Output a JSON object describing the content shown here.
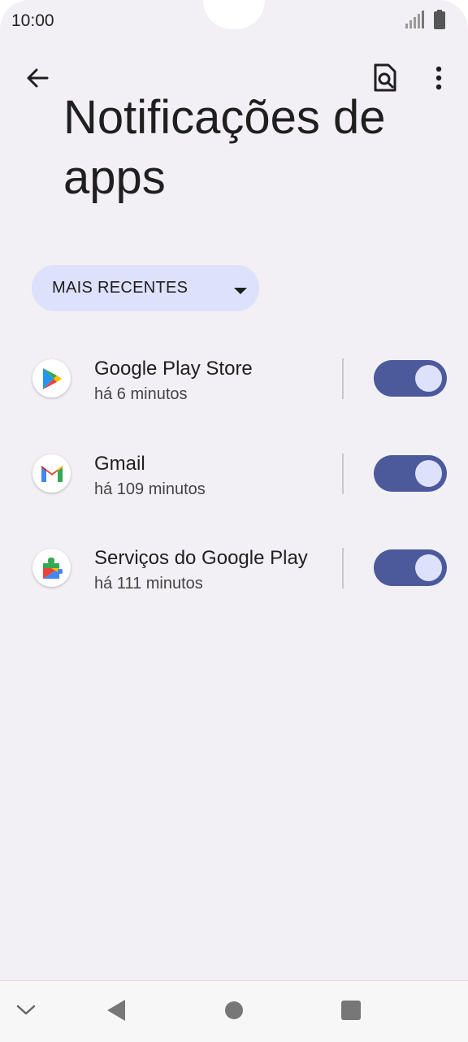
{
  "status_bar": {
    "time": "10:00",
    "icons": [
      "signal-icon",
      "battery-icon"
    ]
  },
  "app_bar": {
    "back_icon": "arrow-left-icon",
    "search_icon": "search-document-icon",
    "more_icon": "more-vertical-icon"
  },
  "page": {
    "title": "Notificações de apps"
  },
  "filter": {
    "selected": "MAIS RECENTES",
    "icon": "caret-down-icon"
  },
  "apps": [
    {
      "name": "Google Play Store",
      "time": "há 6 minutos",
      "icon": "google-play-store-icon",
      "enabled": true
    },
    {
      "name": "Gmail",
      "time": "há 109 minutos",
      "icon": "gmail-icon",
      "enabled": true
    },
    {
      "name": "Serviços do Google Play",
      "time": "há 111 minutos",
      "icon": "google-play-services-icon",
      "enabled": true
    }
  ],
  "colors": {
    "background": "#f2f0f4",
    "chip": "#dde1fb",
    "toggle_track": "#4c5a9c",
    "toggle_knob": "#dde1fb"
  },
  "nav_bar": {
    "icons": [
      "chevron-down-icon",
      "back-triangle-icon",
      "home-circle-icon",
      "recents-square-icon"
    ]
  }
}
